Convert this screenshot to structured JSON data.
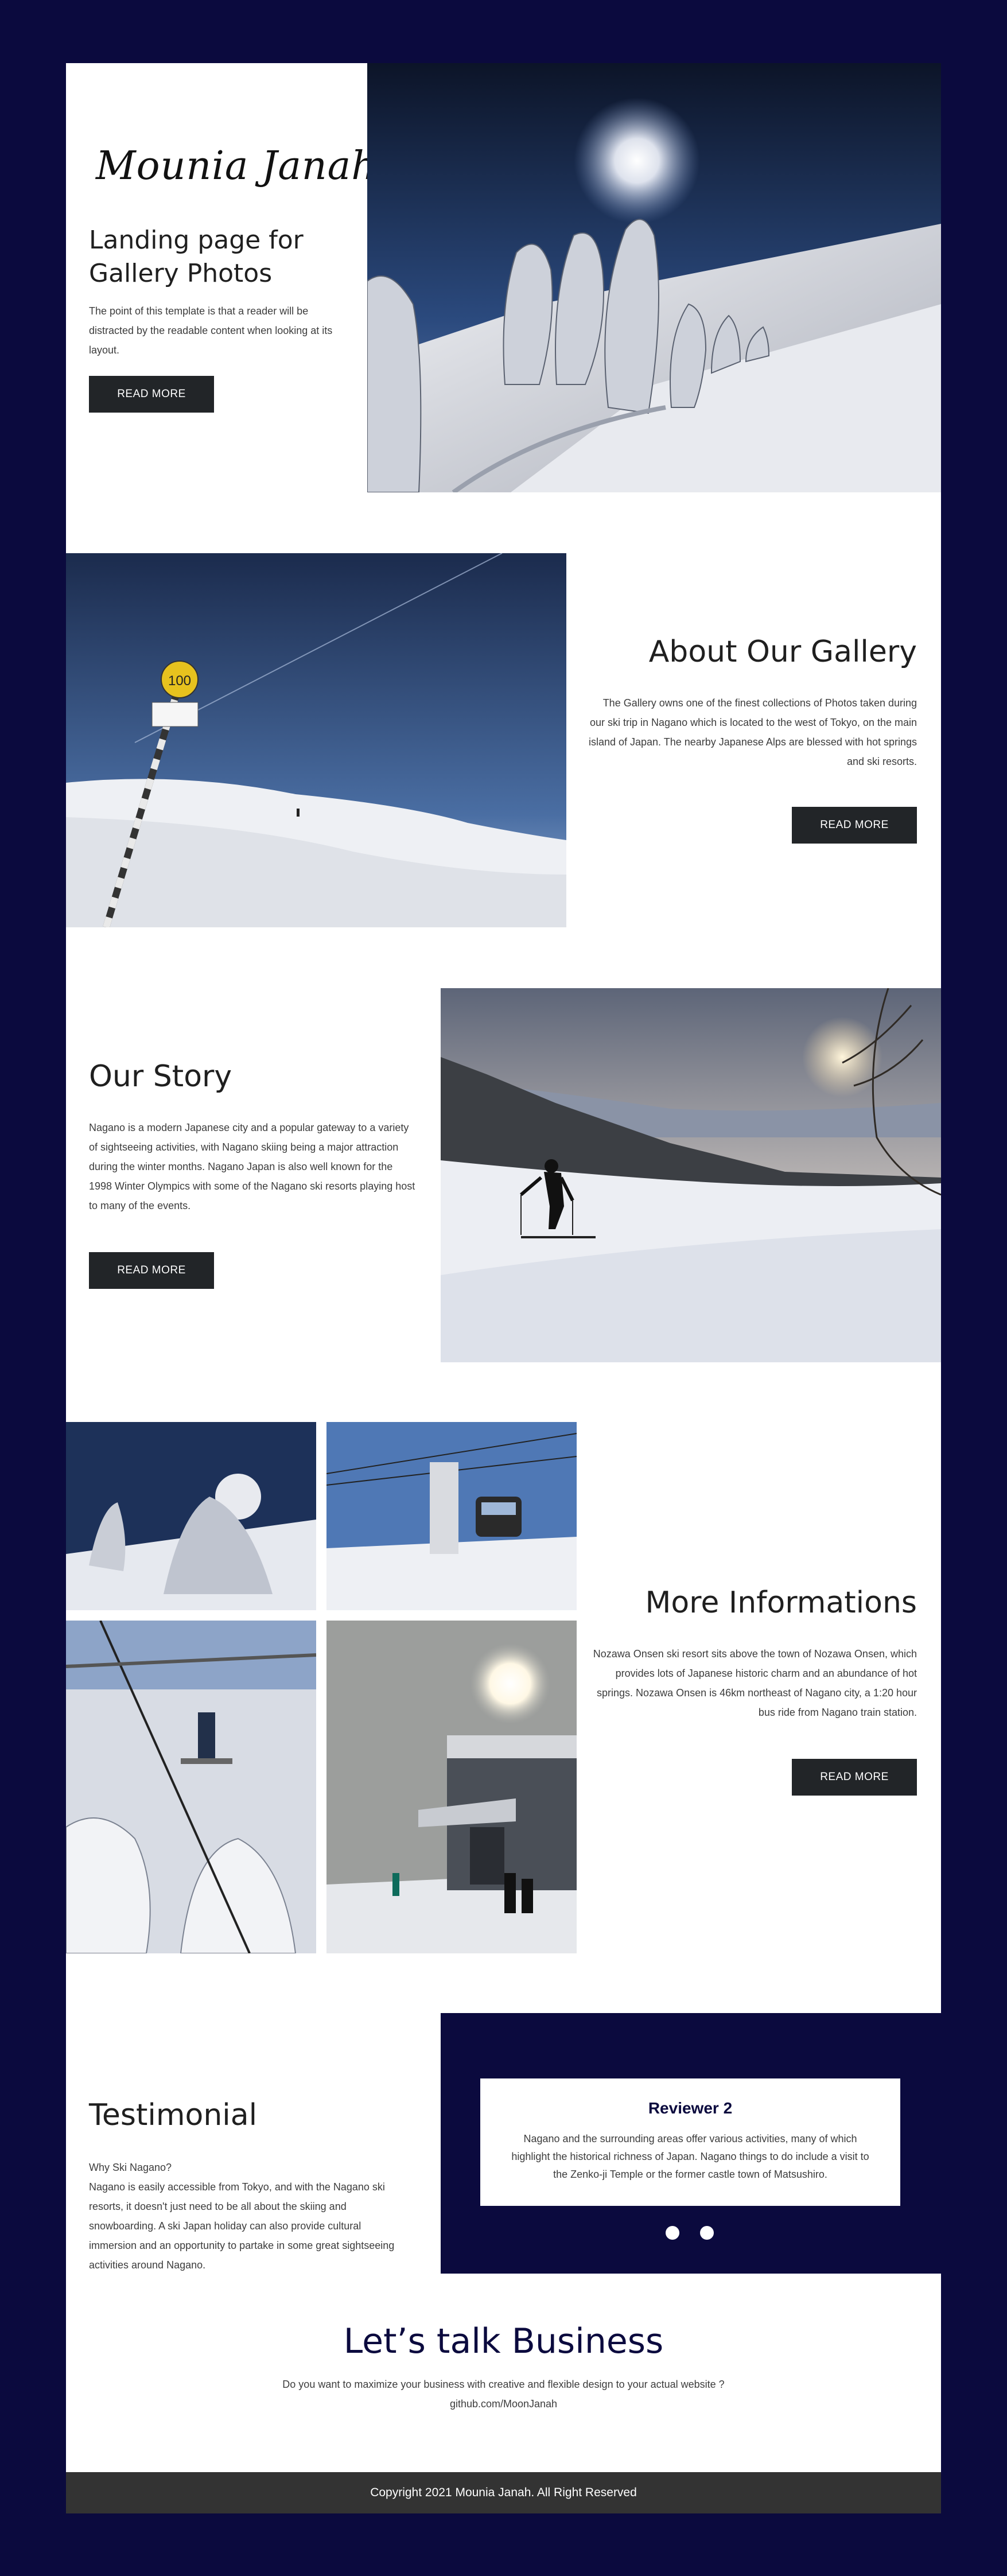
{
  "hero": {
    "logo": "Mounia Janah",
    "title": "Landing page for Gallery Photos",
    "text": "The point of this template is that a reader will be distracted by the readable content when looking at its layout.",
    "button": "READ MORE"
  },
  "about": {
    "title": "About Our Gallery",
    "text": "The Gallery owns one of the finest collections of Photos taken during our ski trip in Nagano which is located to the west of Tokyo, on the main island of Japan. The nearby Japanese Alps are blessed with hot springs and ski resorts.",
    "button": "READ MORE",
    "sign_number": "100"
  },
  "story": {
    "title": "Our Story",
    "text": "Nagano is a modern Japanese city and a popular gateway to a variety of sightseeing activities, with Nagano skiing being a major attraction during the winter months. Nagano Japan is also well known for the 1998 Winter Olympics with some of the Nagano ski resorts playing host to many of the events.",
    "button": "READ MORE"
  },
  "more": {
    "title": "More Informations",
    "text": "Nozawa Onsen ski resort sits above the town of Nozawa Onsen, which provides lots of Japanese historic charm and an abundance of hot springs. Nozawa Onsen is 46km northeast of Nagano city, a 1:20 hour bus ride from Nagano train station.",
    "button": "READ MORE"
  },
  "testimonial": {
    "title": "Testimonial",
    "question": "Why Ski Nagano?",
    "text": "Nagano is easily accessible from Tokyo, and with the Nagano ski resorts, it doesn't just need to be all about the skiing and snowboarding. A ski Japan holiday can also provide cultural immersion and an opportunity to partake in some great sightseeing activities around Nagano.",
    "card_title": "Reviewer 2",
    "card_text": "Nagano and the surrounding areas offer various activities, many of which highlight the historical richness of Japan. Nagano things to do include a visit to the Zenko-ji Temple or the former castle town of Matsushiro."
  },
  "business": {
    "title": "Let’s talk Business",
    "text": "Do you want to maximize your business with creative and flexible design to your actual website ?",
    "link": "github.com/MoonJanah"
  },
  "footer": {
    "text": "Copyright 2021 Mounia Janah. All Right Reserved"
  },
  "colors": {
    "background": "#0b0a3e",
    "button": "#222528",
    "footer": "#333333",
    "accent": "#0b0a3e"
  }
}
